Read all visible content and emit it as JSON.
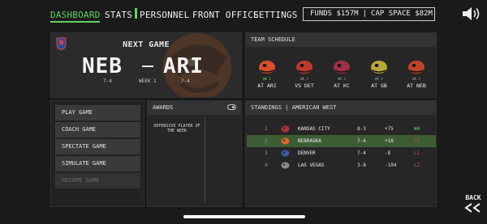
{
  "nav": {
    "dashboard": "DASHBOARD",
    "stats": "STATS",
    "personnel": "PERSONNEL",
    "front_office": "FRONT OFFICE",
    "settings": "SETTINGS",
    "active": "dashboard"
  },
  "finance": {
    "funds": "FUNDS $157M",
    "separator": "|",
    "cap_space": "CAP SPACE $82M"
  },
  "icons": {
    "sound": "speaker-icon",
    "back": "double-chevron-left-icon",
    "team": "shield-icon"
  },
  "next_game": {
    "title": "NEXT GAME",
    "home": "NEB",
    "away": "ARI",
    "home_record": "7-4",
    "away_record": "7-4",
    "week": "WEEK 1"
  },
  "schedule": {
    "title": "TEAM SCHEDULE",
    "games": [
      {
        "week": "WK 1",
        "opponent": "AT ARI",
        "current": true,
        "color": "#d94f2a"
      },
      {
        "week": "WK 2",
        "opponent": "VS DET",
        "current": false,
        "color": "#c0392b"
      },
      {
        "week": "WK 3",
        "opponent": "AT KC",
        "current": false,
        "color": "#a03048"
      },
      {
        "week": "WK 4",
        "opponent": "AT GB",
        "current": false,
        "color": "#b8a83a"
      },
      {
        "week": "WK 5",
        "opponent": "AT NEB",
        "current": false,
        "color": "#c0442a"
      }
    ]
  },
  "menu": {
    "play": "PLAY GAME",
    "coach": "COACH GAME",
    "spectate": "SPECTATE GAME",
    "simulate": "SIMULATE GAME",
    "resume": "RESUME GAME"
  },
  "awards": {
    "title": "AWARDS",
    "award": "DEFENSIVE PLAYER OF THE WEEK"
  },
  "standings": {
    "title": "STANDINGS",
    "separator": "|",
    "division": "AMERICAN WEST",
    "rows": [
      {
        "rank": "1",
        "team": "KANSAS CITY",
        "record": "8-3",
        "diff": "+75",
        "streak": "W4",
        "win": true,
        "user": false,
        "color": "#b03040"
      },
      {
        "rank": "2",
        "team": "NEBRASKA",
        "record": "7-4",
        "diff": "+18",
        "streak": "L1",
        "win": false,
        "user": true,
        "color": "#d86a2a"
      },
      {
        "rank": "3",
        "team": "DENVER",
        "record": "7-4",
        "diff": "-8",
        "streak": "L1",
        "win": false,
        "user": false,
        "color": "#3a5aa0"
      },
      {
        "rank": "4",
        "team": "LAS VEGAS",
        "record": "3-8",
        "diff": "-104",
        "streak": "L2",
        "win": false,
        "user": false,
        "color": "#8a8a8a"
      }
    ]
  },
  "back": {
    "label": "BACK"
  },
  "colors": {
    "accent": "#5fd35f",
    "loss": "#e04848",
    "user_row": "#3e5c34"
  }
}
